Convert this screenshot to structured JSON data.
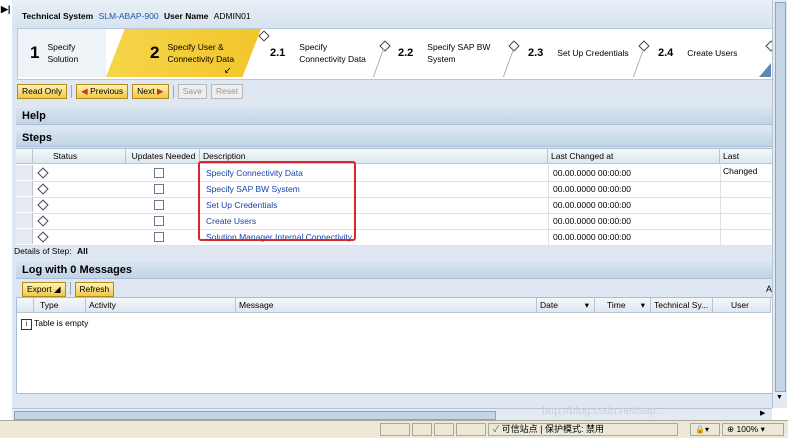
{
  "header": {
    "technical_system_label": "Technical System",
    "technical_system_value": "SLM-ABAP-900",
    "user_name_label": "User Name",
    "user_name_value": "ADMIN01"
  },
  "roadmap": [
    {
      "num": "1",
      "label": "Specify Solution",
      "active": false
    },
    {
      "num": "2",
      "label": "Specify User & Connectivity Data",
      "active": true
    },
    {
      "num": "2.1",
      "label": "Specify Connectivity Data",
      "active": false
    },
    {
      "num": "2.2",
      "label": "Specify SAP BW System",
      "active": false
    },
    {
      "num": "2.3",
      "label": "Set Up Credentials",
      "active": false
    },
    {
      "num": "2.4",
      "label": "Create Users",
      "active": false
    }
  ],
  "toolbar": {
    "read_only": "Read Only",
    "previous": "Previous",
    "next": "Next",
    "save": "Save",
    "reset": "Reset"
  },
  "help_title": "Help",
  "steps_title": "Steps",
  "steps_table": {
    "columns": [
      "Status",
      "Updates Needed",
      "Description",
      "Last Changed at",
      "Last Changed"
    ],
    "rows": [
      {
        "description": "Specify Connectivity Data",
        "last_changed_at": "00.00.0000 00:00:00"
      },
      {
        "description": "Specify SAP BW System",
        "last_changed_at": "00.00.0000 00:00:00"
      },
      {
        "description": "Set Up Credentials",
        "last_changed_at": "00.00.0000 00:00:00"
      },
      {
        "description": "Create Users",
        "last_changed_at": "00.00.0000 00:00:00"
      },
      {
        "description": "Solution Manager Internal Connectivity",
        "last_changed_at": "00.00.0000 00:00:00"
      }
    ]
  },
  "details": {
    "label": "Details of Step:",
    "value": "All"
  },
  "log": {
    "title": "Log with 0 Messages",
    "export": "Export",
    "refresh": "Refresh",
    "columns": [
      "Type",
      "Activity",
      "Message",
      "Date",
      "Time",
      "Technical Sy...",
      "User"
    ],
    "empty_text": "Table is empty"
  },
  "statusbar": {
    "zone": "可信站点 | 保护模式: 禁用",
    "zoom": "100%",
    "watermark": "http://blog.csdn.net/sap..."
  }
}
